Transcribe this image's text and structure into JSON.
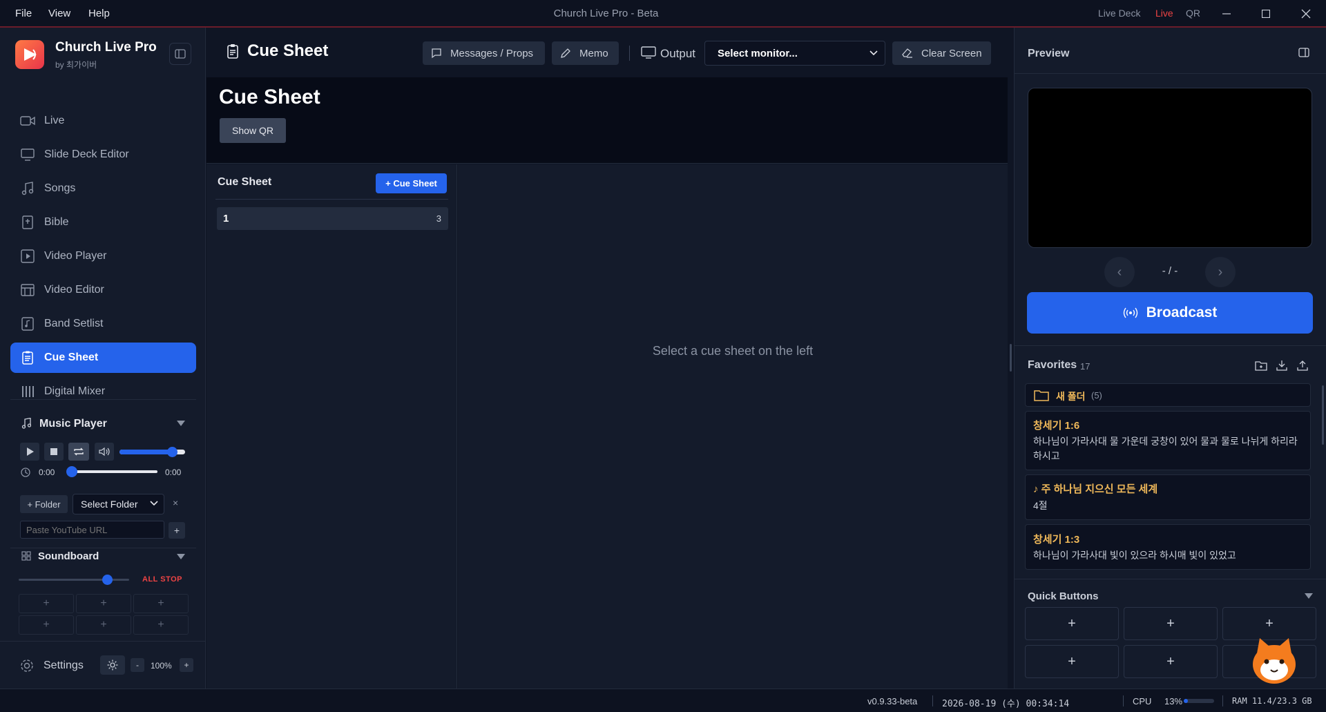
{
  "menu": {
    "file": "File",
    "view": "View",
    "help": "Help"
  },
  "window": {
    "title": "Church Live Pro - Beta",
    "live_deck": "Live Deck",
    "live": "Live",
    "qr": "QR"
  },
  "brand": {
    "name": "Church Live Pro",
    "author": "by 최가이버"
  },
  "nav": {
    "live": "Live",
    "slide_deck": "Slide Deck Editor",
    "songs": "Songs",
    "bible": "Bible",
    "video_player": "Video Player",
    "video_editor": "Video Editor",
    "band_setlist": "Band Setlist",
    "cue_sheet": "Cue Sheet",
    "digital_mixer": "Digital Mixer"
  },
  "music_player": {
    "title": "Music Player",
    "time_start": "0:00",
    "time_end": "0:00",
    "volume": 0.8,
    "progress": 0.0,
    "folder_button": "+ Folder",
    "folder_select": "Select Folder",
    "clear": "×",
    "url_placeholder": "Paste YouTube URL",
    "add": "+"
  },
  "soundboard": {
    "title": "Soundboard",
    "all_stop": "ALL STOP",
    "volume": 0.8,
    "cells": [
      "+",
      "+",
      "+",
      "+",
      "+",
      "+"
    ]
  },
  "settings": {
    "label": "Settings",
    "zoom_minus": "-",
    "zoom": "100%",
    "zoom_plus": "+"
  },
  "header": {
    "title": "Cue Sheet",
    "messages": "Messages / Props",
    "memo": "Memo",
    "output": "Output",
    "monitor": "Select monitor...",
    "clear_screen": "Clear Screen"
  },
  "main": {
    "title": "Cue Sheet",
    "show_qr": "Show QR"
  },
  "cue_list": {
    "title": "Cue Sheet",
    "add": "+ Cue Sheet",
    "items": [
      {
        "name": "1",
        "count": "3"
      }
    ]
  },
  "cue_content": {
    "empty": "Select a cue sheet on the left"
  },
  "preview": {
    "title": "Preview",
    "page": "- / -",
    "prev": "‹",
    "next": "›",
    "broadcast": "Broadcast"
  },
  "favorites": {
    "title": "Favorites",
    "count": "17",
    "folder": {
      "name": "새 폴더",
      "count": "(5)"
    },
    "items": [
      {
        "title": "창세기 1:6",
        "body": "하나님이 가라사대 물 가운데 궁창이 있어 물과 물로 나뉘게 하리라 하시고"
      },
      {
        "title": "♪ 주 하나님 지으신 모든 세계",
        "body": "4절"
      },
      {
        "title": "창세기 1:3",
        "body": "하나님이 가라사대 빛이 있으라 하시매 빛이 있었고"
      }
    ]
  },
  "quick_buttons": {
    "title": "Quick Buttons",
    "cells": [
      "+",
      "+",
      "+",
      "+",
      "+"
    ]
  },
  "status": {
    "version": "v0.9.33-beta",
    "datetime": "2026-08-19 (수) 00:34:14",
    "cpu_label": "CPU",
    "cpu_value": "13%",
    "cpu_fraction": 0.13,
    "ram": "RAM 11.4/23.3 GB"
  },
  "colors": {
    "accent": "#2563eb",
    "live": "#ef4444",
    "favorite_title": "#f0b95a",
    "background": "#0f1524"
  }
}
